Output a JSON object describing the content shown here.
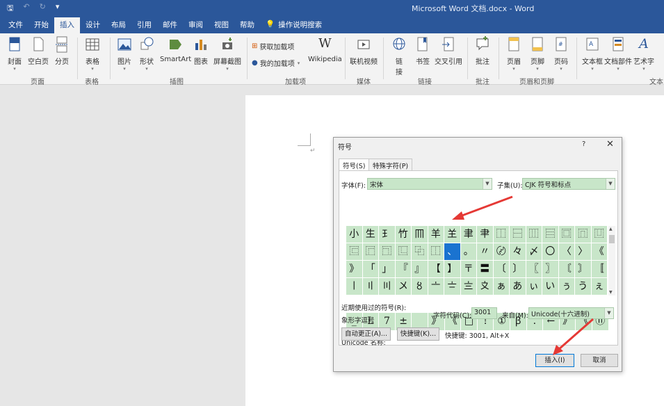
{
  "titlebar": {
    "qat": [
      "save-icon",
      "undo-icon",
      "redo-icon",
      "customize-icon"
    ],
    "title": "Microsoft Word 文档.docx  -  Word"
  },
  "tabs": [
    "文件",
    "开始",
    "插入",
    "设计",
    "布局",
    "引用",
    "邮件",
    "审阅",
    "视图",
    "帮助"
  ],
  "active_tab": "插入",
  "tell_me": "操作说明搜索",
  "ribbon": {
    "groups": [
      {
        "name": "页面",
        "items": [
          "封面",
          "空白页",
          "分页"
        ]
      },
      {
        "name": "表格",
        "items": [
          "表格"
        ]
      },
      {
        "name": "插图",
        "items": [
          "图片",
          "形状",
          "SmartArt",
          "图表",
          "屏幕截图"
        ]
      },
      {
        "name": "加载项",
        "items": [
          "获取加载项",
          "我的加载项",
          "Wikipedia"
        ]
      },
      {
        "name": "媒体",
        "items": [
          "联机视频"
        ]
      },
      {
        "name": "链接",
        "items": [
          "链接",
          "书签",
          "交叉引用"
        ]
      },
      {
        "name": "批注",
        "items": [
          "批注"
        ]
      },
      {
        "name": "页眉和页脚",
        "items": [
          "页眉",
          "页脚",
          "页码"
        ]
      },
      {
        "name": "文本",
        "items": [
          "文本框",
          "文档部件",
          "艺术字"
        ]
      }
    ],
    "link_item_lines": [
      "链",
      "接"
    ]
  },
  "dialog": {
    "title": "符号",
    "help": "?",
    "close": "✕",
    "tabs": [
      "符号(S)",
      "特殊字符(P)"
    ],
    "font_label": "字体(F):",
    "font_value": "宋体",
    "subset_label": "子集(U):",
    "subset_value": "CJK 符号和标点",
    "symbols": [
      "小",
      "生",
      "𤣩",
      "竹",
      "𦉫",
      "羊",
      "𦍌",
      "聿",
      "𦘒",
      "⿰",
      "⿱",
      "⿲",
      "⿳",
      "⿴",
      "⿵",
      "⿶",
      "⿷",
      "⿸",
      "⿹",
      "⿺",
      "⿻",
      "⿰",
      "、",
      "。",
      "〃",
      "〄",
      "々",
      "〆",
      "〇",
      "〈",
      "〉",
      "《",
      "》",
      "「",
      "」",
      "『",
      "』",
      "【",
      "】",
      "〒",
      "〓",
      "〔",
      "〕",
      "〖",
      "〗",
      "〘",
      "〙",
      "〚",
      "〡",
      "〢",
      "〣",
      "〤",
      "〥",
      "〦",
      "〧",
      "〨",
      "〩",
      "ぁ",
      "あ",
      "ぃ",
      "い",
      "ぅ",
      "う",
      "ぇ"
    ],
    "selected_index": 22,
    "recent_label": "近期使用过的符号(R):",
    "recent": [
      "_",
      "L",
      "7",
      "±",
      "",
      "》",
      "《",
      "□",
      "!",
      "①",
      "ꞵ",
      ".",
      "←",
      "》",
      "《",
      "⑪"
    ],
    "unicode_name_label": "Unicode 名称:",
    "unicode_name_value": "象形字逗号",
    "code_label": "字符代码(C):",
    "code_value": "3001",
    "from_label": "来自(M):",
    "from_value": "Unicode(十六进制)",
    "autocorrect_button": "自动更正(A)...",
    "shortcut_button": "快捷键(K)...",
    "shortcut_text": "快捷键: 3001, Alt+X",
    "insert_button": "插入(I)",
    "cancel_button": "取消"
  },
  "colors": {
    "titlebar": "#2b579a",
    "cell_fill": "#c8e6c9",
    "selected": "#1a73d0",
    "annotation_arrow": "#e53935"
  }
}
